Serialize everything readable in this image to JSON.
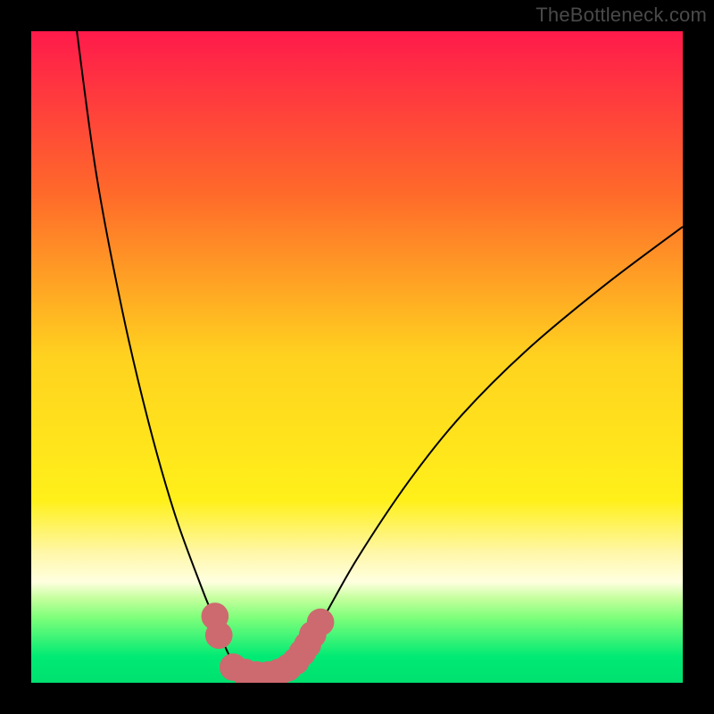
{
  "attribution": "TheBottleneck.com",
  "colors": {
    "frame": "#000000",
    "curve": "#000000",
    "marker": "#cd6a6f",
    "gradient_stops": [
      {
        "offset": 0.0,
        "color": "#ff1a4b"
      },
      {
        "offset": 0.25,
        "color": "#ff6a2a"
      },
      {
        "offset": 0.5,
        "color": "#ffd21f"
      },
      {
        "offset": 0.72,
        "color": "#fff01a"
      },
      {
        "offset": 0.8,
        "color": "#fff7a8"
      },
      {
        "offset": 0.845,
        "color": "#ffffe0"
      },
      {
        "offset": 0.87,
        "color": "#c6ff9e"
      },
      {
        "offset": 0.9,
        "color": "#7eff7a"
      },
      {
        "offset": 0.96,
        "color": "#00ea74"
      },
      {
        "offset": 1.0,
        "color": "#00e070"
      }
    ]
  },
  "chart_data": {
    "type": "line",
    "title": "",
    "xlabel": "",
    "ylabel": "",
    "xlim": [
      0,
      100
    ],
    "ylim": [
      0,
      100
    ],
    "series": [
      {
        "name": "left-branch",
        "x": [
          7.0,
          10.0,
          14.0,
          18.0,
          22.0,
          26.0,
          28.0,
          30.0,
          31.5
        ],
        "y": [
          100.0,
          78.0,
          57.0,
          40.0,
          26.0,
          15.0,
          10.0,
          5.0,
          2.2
        ]
      },
      {
        "name": "right-branch",
        "x": [
          40.0,
          44.0,
          50.0,
          58.0,
          66.0,
          76.0,
          88.0,
          100.0
        ],
        "y": [
          2.6,
          8.5,
          19.0,
          31.0,
          41.0,
          51.0,
          61.0,
          70.0
        ]
      }
    ],
    "markers": {
      "name": "data-points",
      "points": [
        {
          "x": 28.2,
          "y": 10.2
        },
        {
          "x": 28.8,
          "y": 7.3
        },
        {
          "x": 31.0,
          "y": 2.4
        },
        {
          "x": 32.8,
          "y": 1.6
        },
        {
          "x": 34.6,
          "y": 1.2
        },
        {
          "x": 36.4,
          "y": 1.2
        },
        {
          "x": 38.0,
          "y": 1.6
        },
        {
          "x": 39.4,
          "y": 2.3
        },
        {
          "x": 40.6,
          "y": 3.3
        },
        {
          "x": 41.6,
          "y": 4.6
        },
        {
          "x": 42.4,
          "y": 5.8
        },
        {
          "x": 43.2,
          "y": 7.4
        },
        {
          "x": 44.4,
          "y": 9.3
        }
      ],
      "radius": 2.1
    }
  }
}
